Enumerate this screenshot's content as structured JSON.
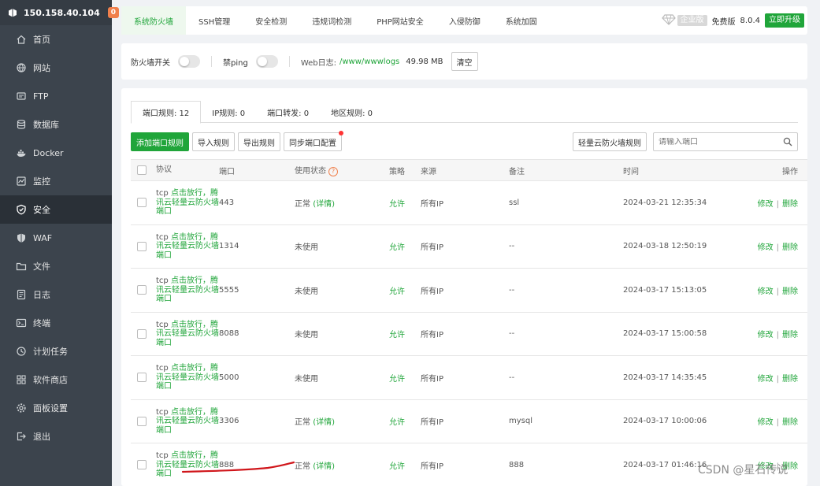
{
  "sidebar": {
    "server_ip": "150.158.40.104",
    "badge": "0",
    "items": [
      {
        "label": "首页",
        "icon": "home-icon"
      },
      {
        "label": "网站",
        "icon": "globe-icon"
      },
      {
        "label": "FTP",
        "icon": "ftp-icon"
      },
      {
        "label": "数据库",
        "icon": "database-icon"
      },
      {
        "label": "Docker",
        "icon": "docker-icon"
      },
      {
        "label": "监控",
        "icon": "monitor-icon"
      },
      {
        "label": "安全",
        "icon": "shield-icon"
      },
      {
        "label": "WAF",
        "icon": "waf-shield-icon"
      },
      {
        "label": "文件",
        "icon": "folder-icon"
      },
      {
        "label": "日志",
        "icon": "log-icon"
      },
      {
        "label": "终端",
        "icon": "terminal-icon"
      },
      {
        "label": "计划任务",
        "icon": "clock-icon"
      },
      {
        "label": "软件商店",
        "icon": "apps-icon"
      },
      {
        "label": "面板设置",
        "icon": "gear-icon"
      },
      {
        "label": "退出",
        "icon": "logout-icon"
      }
    ],
    "active_index": 6
  },
  "topnav": {
    "tabs": [
      "系统防火墙",
      "SSH管理",
      "安全检测",
      "违规词检测",
      "PHP网站安全",
      "入侵防御",
      "系统加固"
    ],
    "enterprise_label": "企业版",
    "free_label": "免费版",
    "version": "8.0.4",
    "upgrade_label": "立即升级"
  },
  "firewall_bar": {
    "firewall_switch_label": "防火墙开关",
    "ping_label": "禁ping",
    "weblog_label": "Web日志:",
    "weblog_path": "/www/wwwlogs",
    "weblog_size": "49.98 MB",
    "clear_label": "清空"
  },
  "subtabs": [
    {
      "label": "端口规则: 12"
    },
    {
      "label": "IP规则: 0"
    },
    {
      "label": "端口转发: 0"
    },
    {
      "label": "地区规则: 0"
    }
  ],
  "toolbar": {
    "add_label": "添加端口规则",
    "import_label": "导入规则",
    "export_label": "导出规则",
    "sync_label": "同步端口配置",
    "tencent_label": "轻量云防火墙规则",
    "search_placeholder": "请输入端口"
  },
  "table": {
    "headers": {
      "proto": "协议",
      "port": "端口",
      "status": "使用状态",
      "policy": "策略",
      "source": "来源",
      "remark": "备注",
      "time": "时间",
      "ops": "操作"
    },
    "proto_prefix": "tcp",
    "proto_link": "点击放行，腾讯云轻量云防火墙端口",
    "edit_label": "修改",
    "delete_label": "删除",
    "rows": [
      {
        "port": "443",
        "status": "正常",
        "detail": "(详情)",
        "policy": "允许",
        "source": "所有IP",
        "remark": "ssl",
        "time": "2024-03-21 12:35:34"
      },
      {
        "port": "1314",
        "status": "未使用",
        "detail": "",
        "policy": "允许",
        "source": "所有IP",
        "remark": "--",
        "time": "2024-03-18 12:50:19"
      },
      {
        "port": "5555",
        "status": "未使用",
        "detail": "",
        "policy": "允许",
        "source": "所有IP",
        "remark": "--",
        "time": "2024-03-17 15:13:05"
      },
      {
        "port": "8088",
        "status": "未使用",
        "detail": "",
        "policy": "允许",
        "source": "所有IP",
        "remark": "--",
        "time": "2024-03-17 15:00:58"
      },
      {
        "port": "5000",
        "status": "未使用",
        "detail": "",
        "policy": "允许",
        "source": "所有IP",
        "remark": "--",
        "time": "2024-03-17 14:35:45"
      },
      {
        "port": "3306",
        "status": "正常",
        "detail": "(详情)",
        "policy": "允许",
        "source": "所有IP",
        "remark": "mysql",
        "time": "2024-03-17 10:00:06"
      },
      {
        "port": "888",
        "status": "正常",
        "detail": "(详情)",
        "policy": "允许",
        "source": "所有IP",
        "remark": "888",
        "time": "2024-03-17 01:46:16"
      }
    ]
  },
  "watermark": "CSDN @星石传说",
  "colors": {
    "accent": "#20a53a",
    "sidebar": "#3c444d",
    "badge": "#f0804c"
  }
}
